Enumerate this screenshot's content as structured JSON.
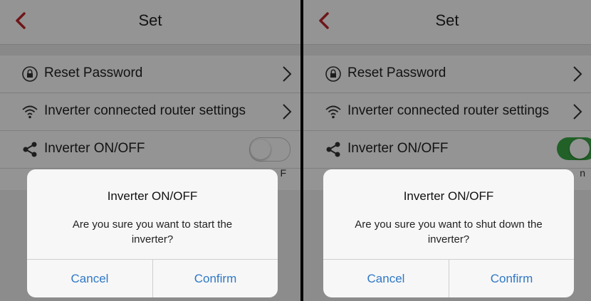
{
  "left_screen": {
    "header": {
      "title": "Set"
    },
    "settings": [
      {
        "label": "Reset Password",
        "icon": "lock-icon"
      },
      {
        "label": "Inverter connected router settings",
        "icon": "wifi-icon"
      },
      {
        "label": "Inverter ON/OFF",
        "icon": "share-icon",
        "toggle": "off"
      }
    ],
    "toggle_note": "F",
    "dialog": {
      "title": "Inverter ON/OFF",
      "message": "Are you sure you want to start the inverter?",
      "cancel": "Cancel",
      "confirm": "Confirm"
    }
  },
  "right_screen": {
    "header": {
      "title": "Set"
    },
    "settings": [
      {
        "label": "Reset Password",
        "icon": "lock-icon"
      },
      {
        "label": "Inverter connected router settings",
        "icon": "wifi-icon"
      },
      {
        "label": "Inverter ON/OFF",
        "icon": "share-icon",
        "toggle": "on"
      }
    ],
    "toggle_note": "n",
    "dialog": {
      "title": "Inverter ON/OFF",
      "message": "Are you sure you want to shut down the inverter?",
      "cancel": "Cancel",
      "confirm": "Confirm"
    }
  },
  "colors": {
    "back_arrow": "#c0272d",
    "toggle_on": "#3aa846",
    "dialog_button": "#2f78c6"
  }
}
